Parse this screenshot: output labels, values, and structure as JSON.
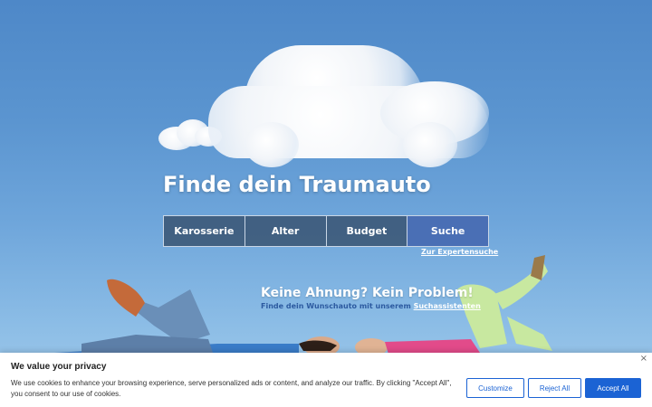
{
  "hero": {
    "title": "Finde dein Traumauto",
    "tabs": [
      {
        "label": "Karosserie"
      },
      {
        "label": "Alter"
      },
      {
        "label": "Budget"
      },
      {
        "label": "Suche"
      }
    ],
    "expert_link": "Zur Expertensuche",
    "subtitle": "Keine Ahnung? Kein Problem!",
    "subline_text": "Finde dein Wunschauto mit unserem ",
    "subline_link": "Suchassistenten"
  },
  "cookie": {
    "title": "We value your privacy",
    "text": "We use cookies to enhance your browsing experience, serve personalized ads or content, and analyze our traffic. By clicking \"Accept All\", you consent to our use of cookies.",
    "close": "×",
    "customize": "Customize",
    "reject": "Reject All",
    "accept": "Accept All"
  },
  "colors": {
    "accent": "#1b63d4",
    "tab_bg": "#37506e",
    "tab_active": "#4a6fb5"
  }
}
